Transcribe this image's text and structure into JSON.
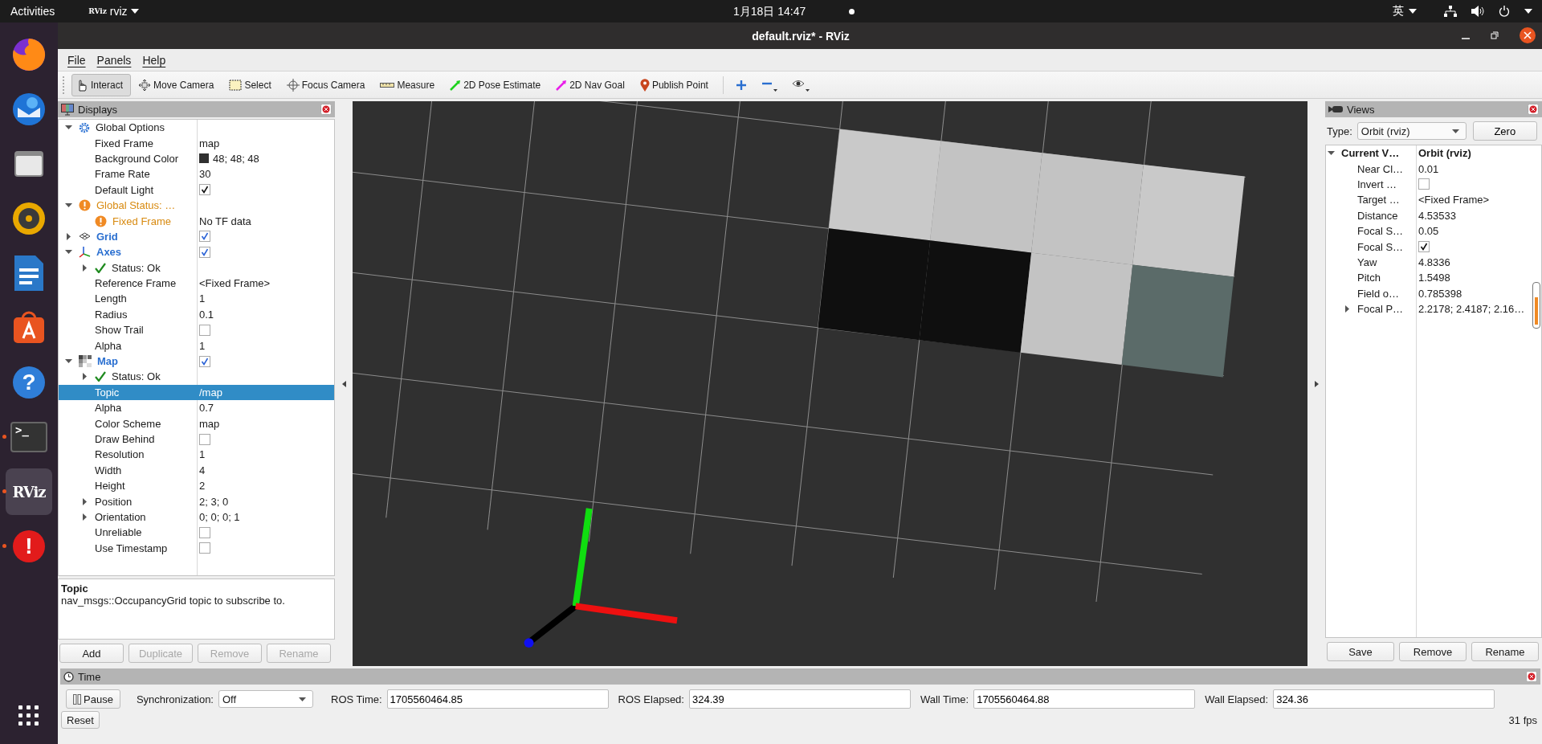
{
  "top_bar": {
    "activities": "Activities",
    "app_logo": "RViz",
    "app_menu": "rviz",
    "clock": "1月18日  14:47",
    "input_method": "英"
  },
  "dock": [
    {
      "kind": "browser",
      "running": false,
      "selected": false
    },
    {
      "kind": "mail",
      "running": false,
      "selected": false
    },
    {
      "kind": "files",
      "running": false,
      "selected": false
    },
    {
      "kind": "music",
      "running": false,
      "selected": false
    },
    {
      "kind": "writer",
      "running": false,
      "selected": false
    },
    {
      "kind": "store",
      "running": false,
      "selected": false
    },
    {
      "kind": "help",
      "glyph": "?",
      "running": false,
      "selected": false
    },
    {
      "kind": "terminal",
      "glyph": ">_",
      "running": true,
      "selected": false
    },
    {
      "kind": "rviz",
      "glyph": "RViz",
      "running": true,
      "selected": true
    },
    {
      "kind": "alert",
      "glyph": "!",
      "running": true,
      "selected": false
    }
  ],
  "window": {
    "title": "default.rviz* - RViz"
  },
  "menu": [
    "File",
    "Panels",
    "Help"
  ],
  "toolbar": [
    {
      "kind": "interact",
      "label": "Interact",
      "selected": true
    },
    {
      "kind": "move",
      "label": "Move Camera",
      "selected": false
    },
    {
      "kind": "select",
      "label": "Select",
      "selected": false
    },
    {
      "kind": "focus",
      "label": "Focus Camera",
      "selected": false
    },
    {
      "kind": "measure",
      "label": "Measure",
      "selected": false
    },
    {
      "kind": "pose",
      "label": "2D Pose Estimate",
      "selected": false
    },
    {
      "kind": "goal",
      "label": "2D Nav Goal",
      "selected": false
    },
    {
      "kind": "point",
      "label": "Publish Point",
      "selected": false
    },
    {
      "kind": "add"
    },
    {
      "kind": "remove"
    },
    {
      "kind": "view"
    }
  ],
  "displays": {
    "title": "Displays",
    "tree": [
      {
        "kind": "category",
        "label": "Global Options",
        "expanded": true,
        "selected": false,
        "children": [
          {
            "kind": "property",
            "label": "Fixed Frame",
            "value": "map",
            "selected": false
          },
          {
            "kind": "property",
            "label": "Background Color",
            "value": "48; 48; 48",
            "color": "#303030",
            "selected": false
          },
          {
            "kind": "property",
            "label": "Frame Rate",
            "value": "30",
            "selected": false
          },
          {
            "kind": "property",
            "label": "Default Light",
            "checked": true,
            "selected": false
          }
        ]
      },
      {
        "kind": "warning",
        "label": "Global Status: …",
        "expanded": true,
        "selected": false,
        "children": [
          {
            "kind": "warning",
            "label": "Fixed Frame",
            "value": "No TF data",
            "selected": false
          }
        ]
      },
      {
        "kind": "grid",
        "label": "Grid",
        "expanded": false,
        "checked": true,
        "selected": false
      },
      {
        "kind": "axes",
        "label": "Axes",
        "expanded": true,
        "checked": true,
        "selected": false,
        "children": [
          {
            "kind": "status",
            "label": "Status: Ok",
            "expanded": false,
            "selected": false
          },
          {
            "kind": "property",
            "label": "Reference Frame",
            "value": "<Fixed Frame>",
            "selected": false
          },
          {
            "kind": "property",
            "label": "Length",
            "value": "1",
            "selected": false
          },
          {
            "kind": "property",
            "label": "Radius",
            "value": "0.1",
            "selected": false
          },
          {
            "kind": "property",
            "label": "Show Trail",
            "checked": false,
            "selected": false
          },
          {
            "kind": "property",
            "label": "Alpha",
            "value": "1",
            "selected": false
          }
        ]
      },
      {
        "kind": "map",
        "label": "Map",
        "expanded": true,
        "checked": true,
        "selected": false,
        "children": [
          {
            "kind": "status",
            "label": "Status: Ok",
            "expanded": false,
            "selected": false
          },
          {
            "kind": "property",
            "label": "Topic",
            "value": "/map",
            "selected": true
          },
          {
            "kind": "property",
            "label": "Alpha",
            "value": "0.7",
            "selected": false
          },
          {
            "kind": "property",
            "label": "Color Scheme",
            "value": "map",
            "selected": false
          },
          {
            "kind": "property",
            "label": "Draw Behind",
            "checked": false,
            "selected": false
          },
          {
            "kind": "property",
            "label": "Resolution",
            "value": "1",
            "selected": false
          },
          {
            "kind": "property",
            "label": "Width",
            "value": "4",
            "selected": false
          },
          {
            "kind": "property",
            "label": "Height",
            "value": "2",
            "selected": false
          },
          {
            "kind": "property",
            "label": "Position",
            "value": "2; 3; 0",
            "expanded": false,
            "selected": false
          },
          {
            "kind": "property",
            "label": "Orientation",
            "value": "0; 0; 0; 1",
            "expanded": false,
            "selected": false
          },
          {
            "kind": "property",
            "label": "Unreliable",
            "checked": false,
            "selected": false
          },
          {
            "kind": "property",
            "label": "Use Timestamp",
            "checked": false,
            "selected": false
          }
        ]
      }
    ],
    "description": {
      "title": "Topic",
      "text": "nav_msgs::OccupancyGrid topic to subscribe to."
    },
    "buttons": [
      {
        "label": "Add",
        "disabled": false
      },
      {
        "label": "Duplicate",
        "disabled": true
      },
      {
        "label": "Remove",
        "disabled": true
      },
      {
        "label": "Rename",
        "disabled": true
      }
    ]
  },
  "views": {
    "title": "Views",
    "type_label": "Type:",
    "type_value": "Orbit (rviz)",
    "zero": "Zero",
    "tree": [
      {
        "kind": "view",
        "label": "Current V…",
        "value": "Orbit (rviz)",
        "expanded": true,
        "selected": false,
        "children": [
          {
            "label": "Near Cl…",
            "value": "0.01",
            "selected": false
          },
          {
            "label": "Invert …",
            "checked": false,
            "selected": false
          },
          {
            "label": "Target …",
            "value": "<Fixed Frame>",
            "selected": false
          },
          {
            "label": "Distance",
            "value": "4.53533",
            "selected": false
          },
          {
            "label": "Focal S…",
            "value": "0.05",
            "selected": false
          },
          {
            "label": "Focal S…",
            "checked": true,
            "selected": false
          },
          {
            "label": "Yaw",
            "value": "4.8336",
            "selected": false
          },
          {
            "label": "Pitch",
            "value": "1.5498",
            "selected": false
          },
          {
            "label": "Field o…",
            "value": "0.785398",
            "selected": false
          },
          {
            "label": "Focal P…",
            "value": "2.2178; 2.4187; 2.16…",
            "expanded": false,
            "selected": false
          }
        ]
      }
    ],
    "buttons": [
      "Save",
      "Remove",
      "Rename"
    ]
  },
  "time": {
    "title": "Time",
    "pause": "Pause",
    "sync_label": "Synchronization:",
    "sync_value": "Off",
    "fields": [
      {
        "label": "ROS Time:",
        "value": "1705560464.85"
      },
      {
        "label": "ROS Elapsed:",
        "value": "324.39"
      },
      {
        "label": "Wall Time:",
        "value": "1705560464.88"
      },
      {
        "label": "Wall Elapsed:",
        "value": "324.36"
      }
    ],
    "reset": "Reset",
    "fps": "31 fps"
  }
}
